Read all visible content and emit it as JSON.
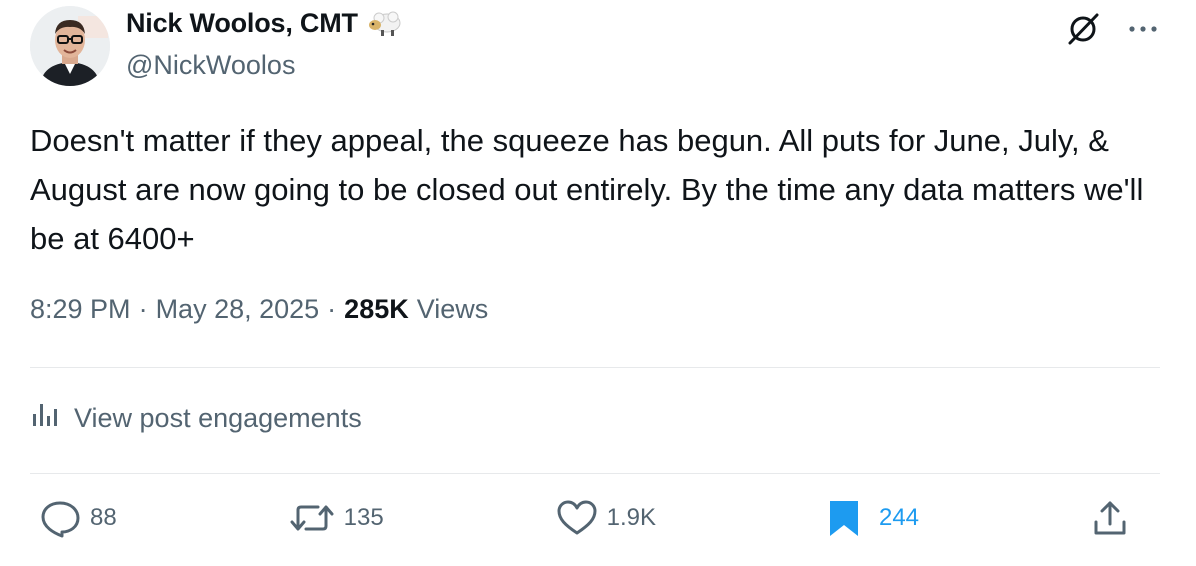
{
  "author": {
    "display_name": "Nick Woolos, CMT",
    "handle": "@NickWoolos",
    "badge_icon": "sheep-icon"
  },
  "post": {
    "text": "Doesn't matter if they appeal, the squeeze has begun. All puts for June, July, & August are now going to be closed out entirely. By the time any data matters we'll be at 6400+",
    "time": "8:29 PM",
    "date": "May 28, 2025",
    "separator": "·",
    "views_count": "285K",
    "views_label": "Views"
  },
  "engagements_link": {
    "icon": "bar-chart-icon",
    "label": "View post engagements"
  },
  "actions": {
    "reply": {
      "icon": "reply-icon",
      "count": "88"
    },
    "repost": {
      "icon": "repost-icon",
      "count": "135"
    },
    "like": {
      "icon": "heart-icon",
      "count": "1.9K"
    },
    "bookmark": {
      "icon": "bookmark-filled-icon",
      "count": "244",
      "active": true
    },
    "share": {
      "icon": "share-icon"
    }
  },
  "colors": {
    "text": "#0f1419",
    "secondary": "#536471",
    "accent": "#1d9bf0",
    "divider": "#e7e9eb"
  }
}
